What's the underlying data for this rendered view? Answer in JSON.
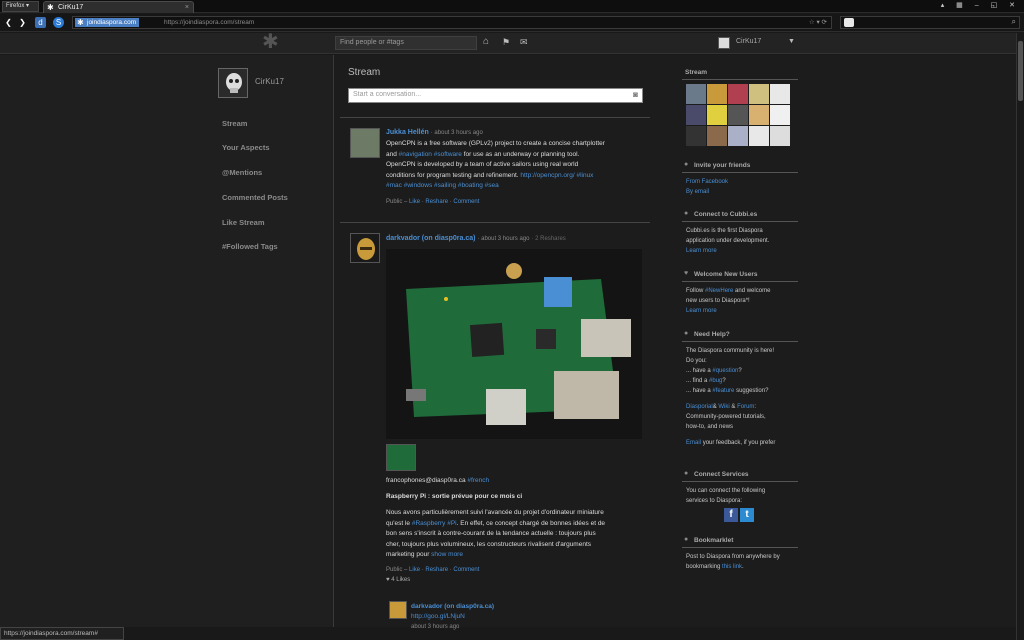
{
  "browser": {
    "menu_label": "Firefox ▾",
    "tab_title": "CirKu17",
    "tab_close": "×",
    "url_host": "joindiaspora.com",
    "url_full": "https://joindiaspora.com/stream",
    "status_url": "https://joindiaspora.com/stream#"
  },
  "header": {
    "search_placeholder": "Find people or #tags",
    "user_name": "CirKu17",
    "dropdown": "▼"
  },
  "profile": {
    "name": "CirKu17"
  },
  "sidebar": {
    "items": [
      {
        "label": "Stream"
      },
      {
        "label": "Your Aspects"
      },
      {
        "label": "@Mentions"
      },
      {
        "label": "Commented Posts"
      },
      {
        "label": "Like Stream"
      },
      {
        "label": "#Followed Tags"
      }
    ]
  },
  "stream": {
    "title": "Stream",
    "composer_placeholder": "Start a conversation..."
  },
  "post1": {
    "author": "Jukka Hellén",
    "time": "· about 3 hours ago",
    "l1": "OpenCPN is a free software (GPLv2) project to create a concise chartplotter",
    "l2a": "and",
    "l2tag": "#navigation #software",
    "l2b": "for use as an underway or planning tool.",
    "l3": "OpenCPN is developed by a team of active sailors using real world",
    "l4a": "conditions for program testing and refinement.",
    "l4link": "http://opencpn.org/",
    "l4tag": "#linux",
    "l5tags": "#mac #windows #sailing #boating #sea",
    "footer_pub": "Public –",
    "like": "Like",
    "reshare": "Reshare",
    "comment": "Comment"
  },
  "post2": {
    "author": "darkvador (on diasp0ra.ca)",
    "time": "· about 3 hours ago",
    "reshares": "· 2 Reshares",
    "line1a": "francophones@diasp0ra.ca",
    "line1tag": "#french",
    "headline": "Raspberry Pi : sortie prévue pour ce mois ci",
    "b1": "Nous avons particulièrement suivi l'avancée du projet d'ordinateur miniature",
    "b2a": "qu'est le",
    "b2tag": "#Raspberry #Pi",
    "b2b": ". En effet, ce concept chargé de bonnes idées et de",
    "b3": "bon sens s'inscrit à contre-courant de la tendance actuelle : toujours plus",
    "b4": "cher, toujours plus volumineux, les constructeurs rivalisent d'arguments",
    "b5a": "marketing pour",
    "b5link": "show more",
    "footer_pub": "Public –",
    "like": "Like",
    "reshare": "Reshare",
    "comment": "Comment",
    "likes": "4 Likes",
    "c_author": "darkvador (on diasp0ra.ca)",
    "c_link": "http://goo.gl/LNjuN",
    "c_time": "about 3 hours ago"
  },
  "right": {
    "stream_title": "Stream",
    "invite_title": "Invite your friends",
    "invite_fb": "From Facebook",
    "invite_email": "By email",
    "cubbies_title": "Connect to Cubbi.es",
    "cubbies_t1": "Cubbi.es is the first Diaspora",
    "cubbies_t2": "application under development.",
    "cubbies_learn": "Learn more",
    "welcome_title": "Welcome New Users",
    "welcome_t1a": "Follow",
    "welcome_tag": "#NewHere",
    "welcome_t1b": "and welcome",
    "welcome_t2": "new users to Diaspora*!",
    "welcome_learn": "Learn more",
    "help_title": "Need Help?",
    "help_t1": "The Diaspora community is here!",
    "help_t2": "Do you:",
    "help_q1a": "... have a",
    "help_q1tag": "#question",
    "help_q1b": "?",
    "help_q2a": "... find a",
    "help_q2tag": "#bug",
    "help_q2b": "?",
    "help_q3a": "... have a",
    "help_q3tag": "#feature",
    "help_q3b": "suggestion?",
    "help_l1": "Diasporial",
    "help_l1b": "&",
    "help_l2": "Wiki",
    "help_l2b": "&",
    "help_l3": "Forum",
    "help_t3": "Community-powered tutorials,",
    "help_t4": "how-to, and news",
    "help_email": "Email",
    "help_t5": "your feedback, if you prefer",
    "services_title": "Connect Services",
    "services_t1": "You can connect the following",
    "services_t2": "services to Diaspora:",
    "bookmarklet_title": "Bookmarklet",
    "bm_t1": "Post to Diaspora from anywhere by",
    "bm_t2a": "bookmarking",
    "bm_link": "this link"
  },
  "colors": {
    "link": "#4a8fd4",
    "bg": "#191919",
    "accent_url": "#4b7fc4"
  }
}
